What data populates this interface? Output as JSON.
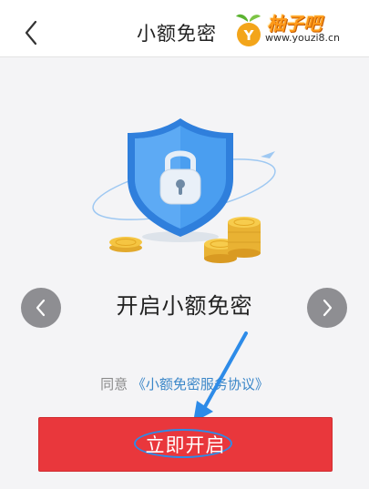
{
  "navbar": {
    "title": "小额免密"
  },
  "watermark": {
    "brand": "柚子吧",
    "url": "www.youzi8.cn"
  },
  "feature": {
    "title": "开启小额免密"
  },
  "agreement": {
    "prefix": "同意",
    "link": "《小额免密服务协议》"
  },
  "action": {
    "label": "立即开启"
  },
  "colors": {
    "primary_button": "#e9373c",
    "link": "#3a86c8",
    "shield": "#3d8ee6",
    "annotation": "#2d8be8",
    "coin": "#f5c542"
  },
  "icons": [
    "back-icon",
    "lock-shield-icon",
    "coin-stack-icon",
    "plane-icon",
    "chevron-left-icon",
    "chevron-right-icon"
  ]
}
